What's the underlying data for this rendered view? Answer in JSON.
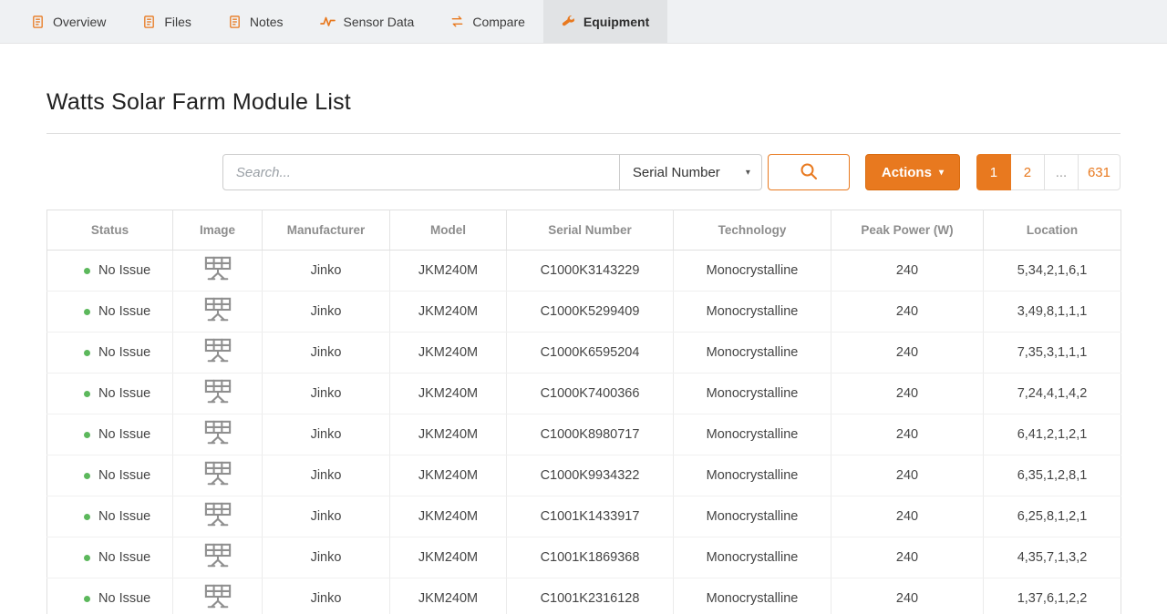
{
  "nav": {
    "tabs": [
      {
        "label": "Overview"
      },
      {
        "label": "Files"
      },
      {
        "label": "Notes"
      },
      {
        "label": "Sensor Data"
      },
      {
        "label": "Compare"
      },
      {
        "label": "Equipment"
      }
    ]
  },
  "page": {
    "title": "Watts Solar Farm Module List"
  },
  "toolbar": {
    "search_placeholder": "Search...",
    "filter_selected": "Serial Number",
    "actions_label": "Actions",
    "pagination": [
      "1",
      "2",
      "...",
      "631"
    ]
  },
  "icons": {
    "caret_down": "▾"
  },
  "table": {
    "columns": [
      "Status",
      "Image",
      "Manufacturer",
      "Model",
      "Serial Number",
      "Technology",
      "Peak Power (W)",
      "Location"
    ],
    "rows": [
      {
        "status": "No Issue",
        "manufacturer": "Jinko",
        "model": "JKM240M",
        "serial": "C1000K3143229",
        "technology": "Monocrystalline",
        "peak_power": "240",
        "location": "5,34,2,1,6,1"
      },
      {
        "status": "No Issue",
        "manufacturer": "Jinko",
        "model": "JKM240M",
        "serial": "C1000K5299409",
        "technology": "Monocrystalline",
        "peak_power": "240",
        "location": "3,49,8,1,1,1"
      },
      {
        "status": "No Issue",
        "manufacturer": "Jinko",
        "model": "JKM240M",
        "serial": "C1000K6595204",
        "technology": "Monocrystalline",
        "peak_power": "240",
        "location": "7,35,3,1,1,1"
      },
      {
        "status": "No Issue",
        "manufacturer": "Jinko",
        "model": "JKM240M",
        "serial": "C1000K7400366",
        "technology": "Monocrystalline",
        "peak_power": "240",
        "location": "7,24,4,1,4,2"
      },
      {
        "status": "No Issue",
        "manufacturer": "Jinko",
        "model": "JKM240M",
        "serial": "C1000K8980717",
        "technology": "Monocrystalline",
        "peak_power": "240",
        "location": "6,41,2,1,2,1"
      },
      {
        "status": "No Issue",
        "manufacturer": "Jinko",
        "model": "JKM240M",
        "serial": "C1000K9934322",
        "technology": "Monocrystalline",
        "peak_power": "240",
        "location": "6,35,1,2,8,1"
      },
      {
        "status": "No Issue",
        "manufacturer": "Jinko",
        "model": "JKM240M",
        "serial": "C1001K1433917",
        "technology": "Monocrystalline",
        "peak_power": "240",
        "location": "6,25,8,1,2,1"
      },
      {
        "status": "No Issue",
        "manufacturer": "Jinko",
        "model": "JKM240M",
        "serial": "C1001K1869368",
        "technology": "Monocrystalline",
        "peak_power": "240",
        "location": "4,35,7,1,3,2"
      },
      {
        "status": "No Issue",
        "manufacturer": "Jinko",
        "model": "JKM240M",
        "serial": "C1001K2316128",
        "technology": "Monocrystalline",
        "peak_power": "240",
        "location": "1,37,6,1,2,2"
      }
    ]
  },
  "colors": {
    "accent": "#e8791f",
    "accent_dark": "#d96b0e",
    "status_ok": "#5cb85c",
    "icon_gray": "#8f8f8f"
  }
}
